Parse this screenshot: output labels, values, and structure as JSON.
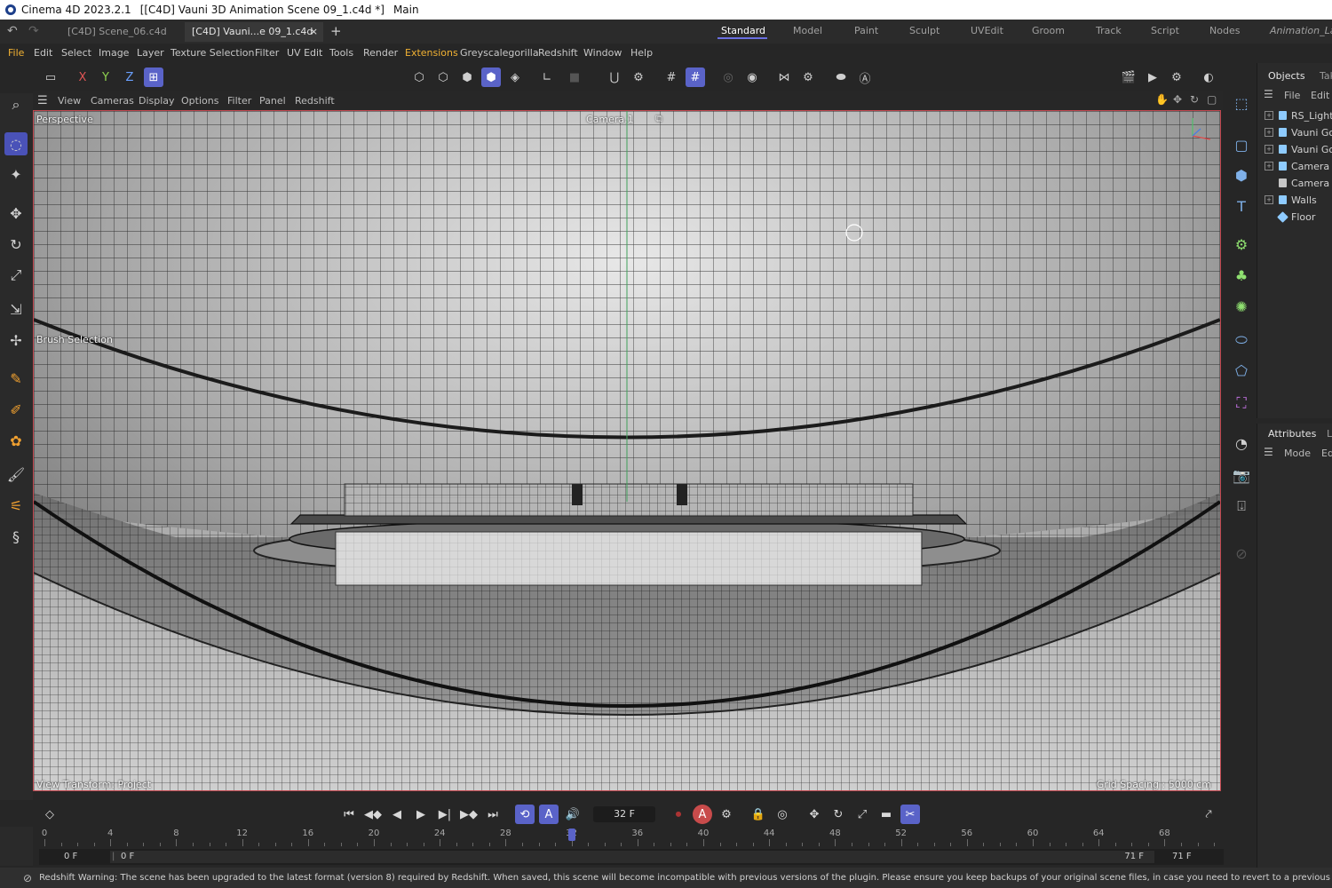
{
  "titlebar": {
    "app": "Cinema 4D 2023.2.1",
    "document": "[[C4D] Vauni 3D Animation Scene 09_1.c4d *]",
    "workspace": "Main"
  },
  "doc_tabs": [
    {
      "label": "[C4D] Scene_06.c4d",
      "active": false
    },
    {
      "label": "[C4D] Vauni...e 09_1.c4d *",
      "active": true
    }
  ],
  "layout_tabs": [
    "Standard",
    "Model",
    "Paint",
    "Sculpt",
    "UVEdit",
    "Groom",
    "Track",
    "Script",
    "Nodes",
    "Animation_Lay"
  ],
  "active_layout": "Standard",
  "menu": [
    "File",
    "Edit",
    "Select",
    "Image",
    "Layer",
    "Texture Selection",
    "Filter",
    "UV Edit",
    "Tools",
    "Render",
    "Extensions",
    "Greyscalegorilla",
    "Redshift",
    "Window",
    "Help"
  ],
  "axis_toggles": [
    "X",
    "Y",
    "Z"
  ],
  "viewport_menu": [
    "View",
    "Cameras",
    "Display",
    "Options",
    "Filter",
    "Panel",
    "Redshift"
  ],
  "viewport": {
    "projection": "Perspective",
    "camera": "Camera.1",
    "tool": "Brush Selection",
    "view_transform": "View Transform: Project",
    "grid_spacing": "Grid Spacing : 5000 cm"
  },
  "objects_panel": {
    "tabs": [
      "Objects",
      "Tak"
    ],
    "menu": [
      "File",
      "Edit"
    ],
    "items": [
      "RS_Lights",
      "Vauni Gob",
      "Vauni Gob",
      "Camera",
      "Camera",
      "Walls",
      "Floor"
    ]
  },
  "attributes_panel": {
    "tabs": [
      "Attributes",
      "L"
    ],
    "menu": [
      "Mode",
      "Edi"
    ]
  },
  "timeline": {
    "current_frame": "32 F",
    "current_value": 32,
    "ticks": [
      "0",
      "4",
      "8",
      "12",
      "16",
      "20",
      "24",
      "28",
      "32",
      "36",
      "40",
      "44",
      "48",
      "52",
      "56",
      "60",
      "64",
      "68"
    ],
    "range_start": "0 F",
    "preview_start": "0 F",
    "preview_end": "71 F",
    "range_end": "71 F"
  },
  "status": "Redshift Warning: The scene has been upgraded to the latest format (version 8) required by Redshift. When saved, this scene will become incompatible with previous versions of the plugin. Please ensure you keep backups of your original scene files, in case you need to revert to a previous version. Path: C:\\Users\\",
  "colors": {
    "accent": "#5a63c8",
    "viewport_border": "#c0474f",
    "object_icon": "#8ecbff"
  }
}
